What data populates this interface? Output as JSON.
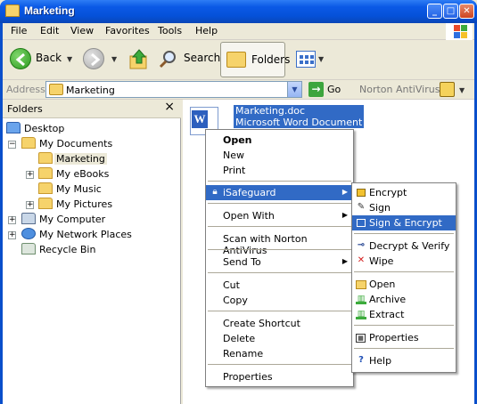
{
  "window": {
    "title": "Marketing"
  },
  "menubar": {
    "items": [
      "File",
      "Edit",
      "View",
      "Favorites",
      "Tools",
      "Help"
    ]
  },
  "toolbar": {
    "back": "Back",
    "search": "Search",
    "folders": "Folders"
  },
  "address": {
    "label": "Address",
    "value": "Marketing",
    "go": "Go",
    "norton": "Norton AntiVirus"
  },
  "folders_pane": {
    "title": "Folders",
    "tree": [
      "Desktop",
      "My Documents",
      "Marketing",
      "My eBooks",
      "My Music",
      "My Pictures",
      "My Computer",
      "My Network Places",
      "Recycle Bin"
    ]
  },
  "file": {
    "name": "Marketing.doc",
    "type": "Microsoft Word Document"
  },
  "context_menu": {
    "items": [
      "Open",
      "New",
      "Print",
      "iSafeguard",
      "Open With",
      "Scan with Norton AntiVirus",
      "Send To",
      "Cut",
      "Copy",
      "Create Shortcut",
      "Delete",
      "Rename",
      "Properties"
    ]
  },
  "submenu": {
    "items": [
      "Encrypt",
      "Sign",
      "Sign & Encrypt",
      "Decrypt & Verify",
      "Wipe",
      "Open",
      "Archive",
      "Extract",
      "Properties",
      "Help"
    ],
    "icons": [
      "lock-icon",
      "pen-icon",
      "lock-icon",
      "key-icon",
      "x-icon",
      "folder-open-icon",
      "archive-icon",
      "extract-icon",
      "properties-icon",
      "help-icon"
    ]
  },
  "colors": {
    "selection": "#316AC5",
    "title_bar": "#0551D8",
    "chrome": "#ECE9D8"
  }
}
